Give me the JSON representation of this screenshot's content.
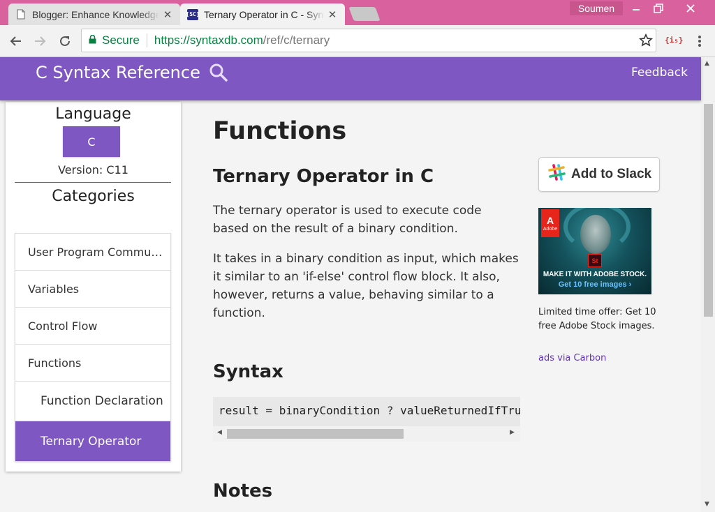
{
  "browser": {
    "tabs": [
      {
        "title": "Blogger: Enhance Knowledge",
        "active": false,
        "favicon": "page-icon"
      },
      {
        "title": "Ternary Operator in C - SyntaxDB",
        "active": true,
        "favicon": "sc-favicon",
        "favicon_text": "[SC]"
      }
    ],
    "profile_name": "Soumen",
    "secure_label": "Secure",
    "url_scheme": "https://",
    "url_host": "syntaxdb.com",
    "url_path": "/ref/c/ternary",
    "extension_label": "{i₅}"
  },
  "site": {
    "title": "C Syntax Reference",
    "feedback_label": "Feedback",
    "accent_color": "#7e57c2"
  },
  "sidebar": {
    "language_heading": "Language",
    "language_button": "C",
    "version": "Version: C11",
    "categories_heading": "Categories",
    "categories": [
      {
        "label": "User Program Commu…",
        "sub": false,
        "active": false
      },
      {
        "label": "Variables",
        "sub": false,
        "active": false
      },
      {
        "label": "Control Flow",
        "sub": false,
        "active": false
      },
      {
        "label": "Functions",
        "sub": false,
        "active": false
      },
      {
        "label": "Function Declaration",
        "sub": true,
        "active": false
      },
      {
        "label": "Ternary Operator",
        "sub": true,
        "active": true
      }
    ]
  },
  "main": {
    "section_title": "Functions",
    "page_title": "Ternary Operator in C",
    "paragraphs": [
      "The ternary operator is used to execute code based on the result of a binary condition.",
      "It takes in a binary condition as input, which makes it similar to an 'if-else' control flow block. It also, however, returns a value, behaving similar to a function."
    ],
    "syntax_title": "Syntax",
    "code": "result = binaryCondition ? valueReturnedIfTrue : valueReturnedIfFalse;",
    "notes_title": "Notes"
  },
  "aside": {
    "slack_label": "Add to Slack",
    "ad_brand": "Adobe",
    "ad_badge": "St",
    "ad_headline": "MAKE IT WITH ADOBE STOCK.",
    "ad_cta": "Get 10 free images ›",
    "ad_text": "Limited time offer: Get 10 free Adobe Stock images.",
    "ad_via": "ads via Carbon"
  }
}
